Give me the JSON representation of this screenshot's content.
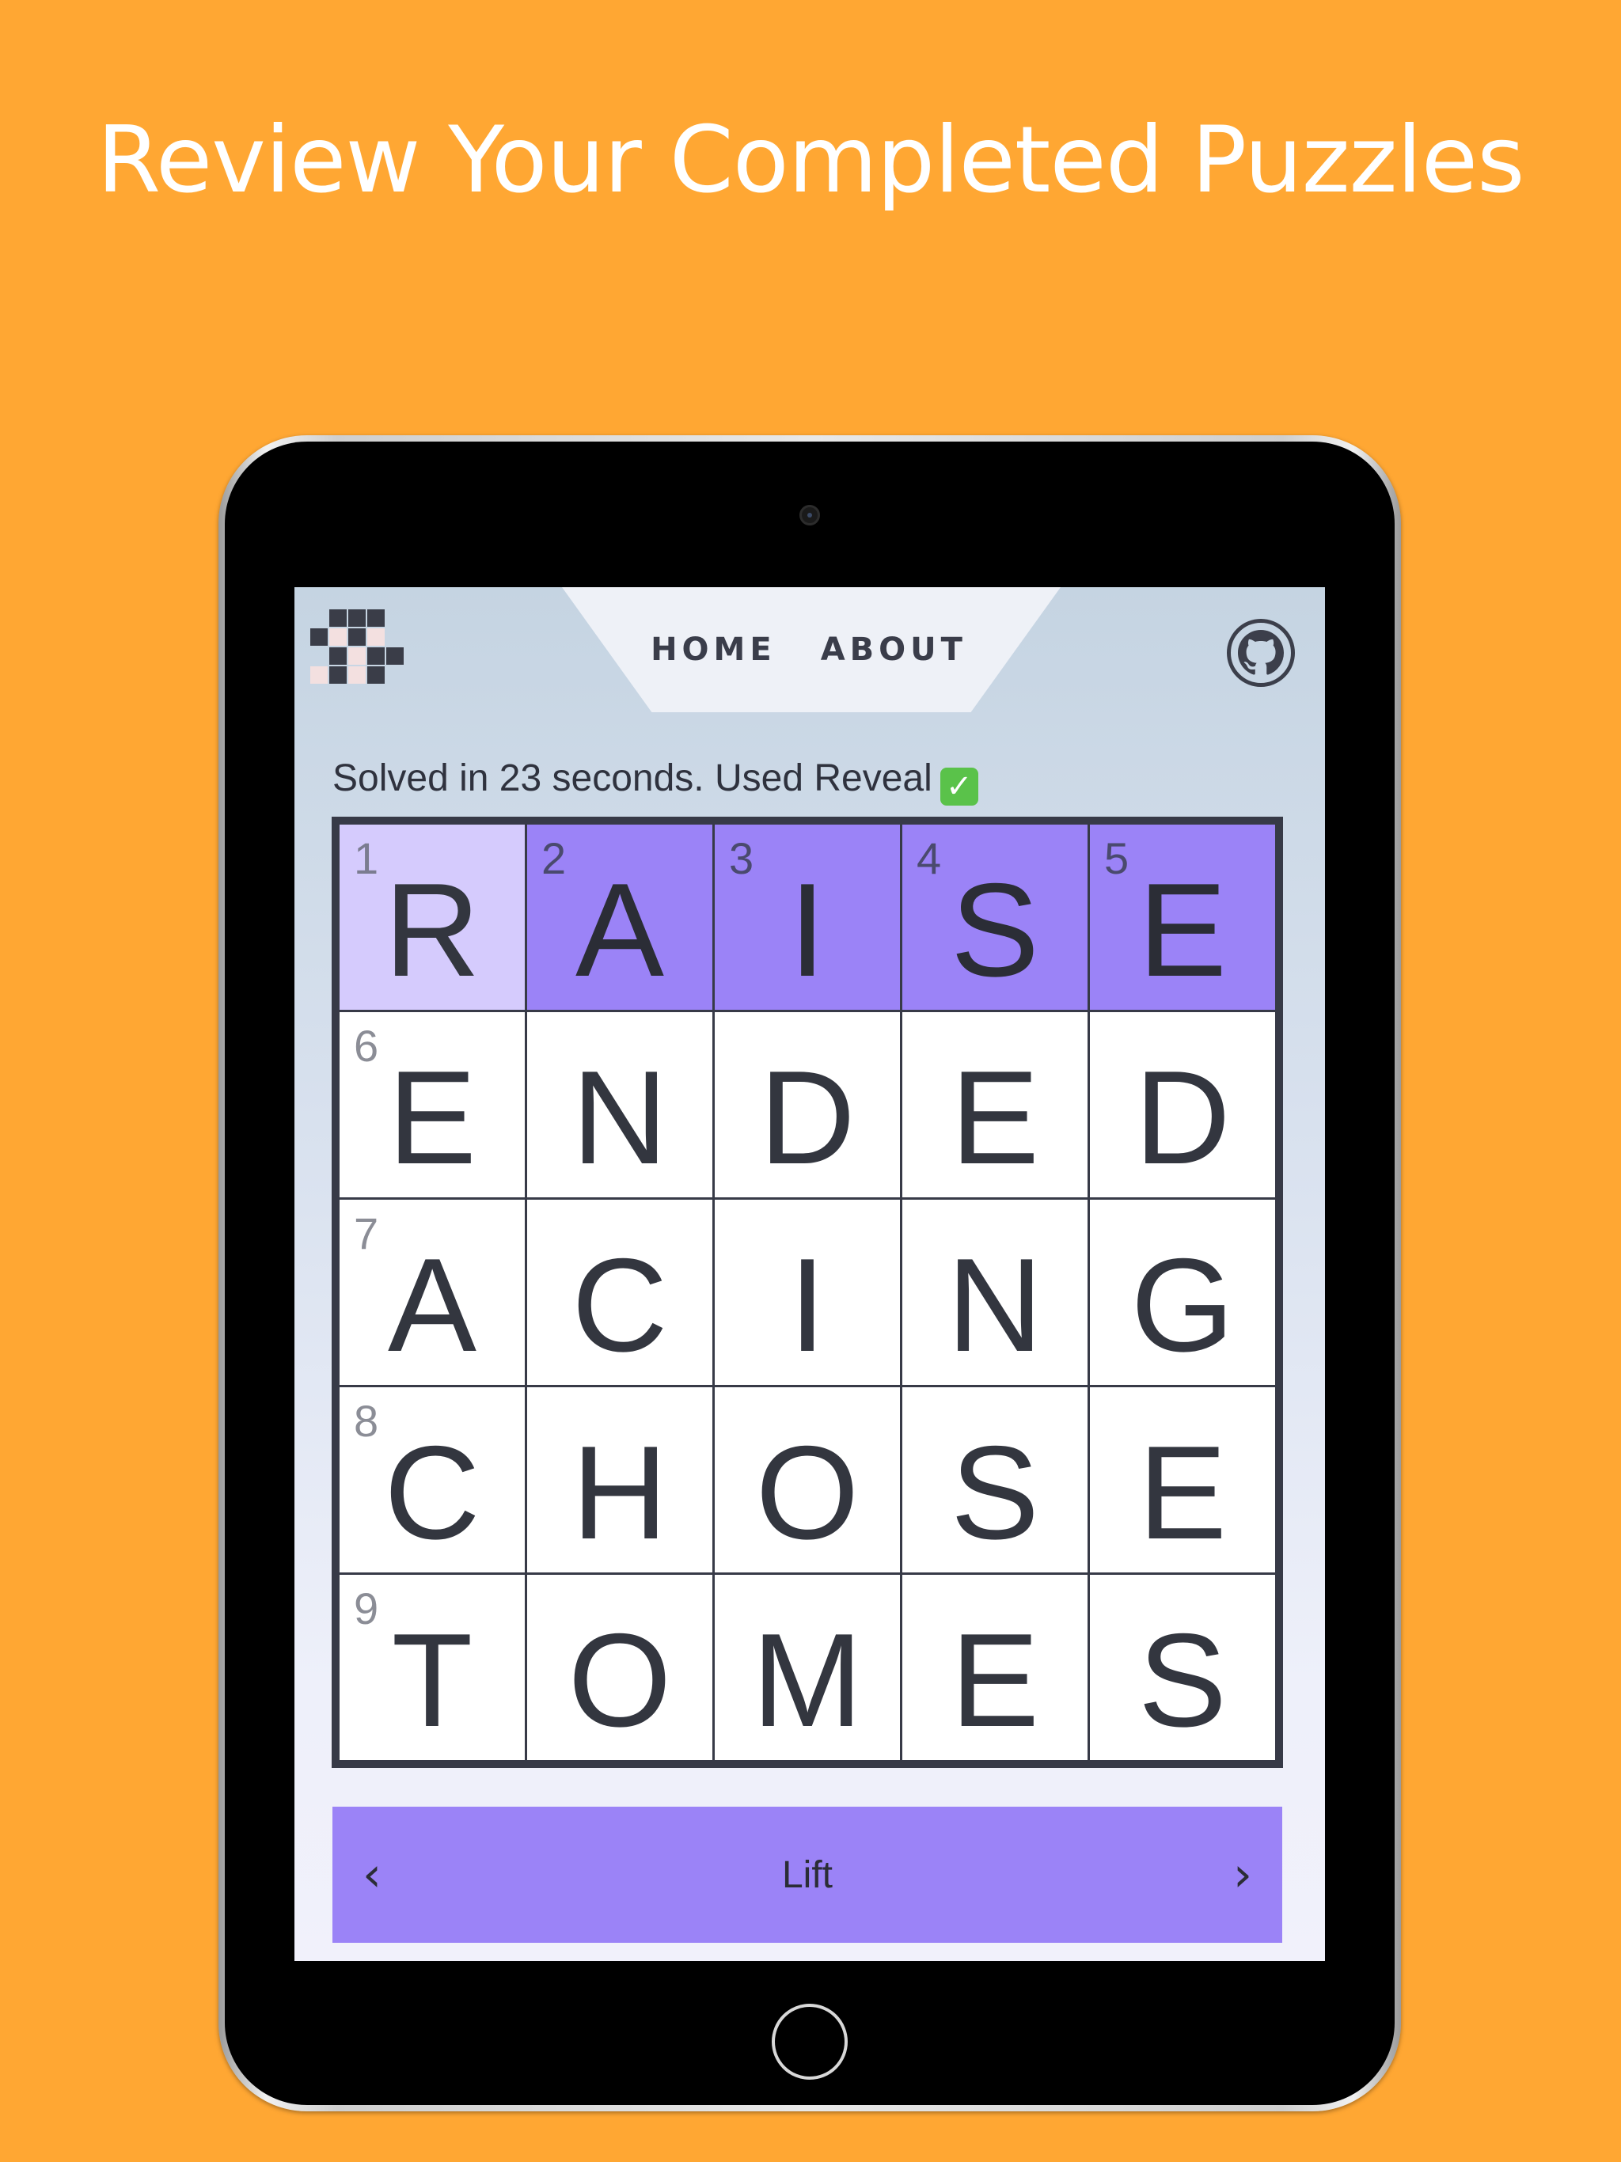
{
  "headline": "Review Your Completed Puzzles",
  "nav": {
    "home": "HOME",
    "about": "ABOUT"
  },
  "status": {
    "text": "Solved in 23 seconds. Used Reveal",
    "check": "✓"
  },
  "grid": {
    "rows": [
      [
        "R",
        "A",
        "I",
        "S",
        "E"
      ],
      [
        "E",
        "N",
        "D",
        "E",
        "D"
      ],
      [
        "A",
        "C",
        "I",
        "N",
        "G"
      ],
      [
        "C",
        "H",
        "O",
        "S",
        "E"
      ],
      [
        "T",
        "O",
        "M",
        "E",
        "S"
      ]
    ],
    "numbers": {
      "r0c0": "1",
      "r0c1": "2",
      "r0c2": "3",
      "r0c3": "4",
      "r0c4": "5",
      "r1c0": "6",
      "r2c0": "7",
      "r3c0": "8",
      "r4c0": "9"
    }
  },
  "clue": {
    "text": "Lift",
    "prev": "‹",
    "next": "›"
  },
  "icons": {
    "logo": "crossword-logo-icon",
    "github": "github-icon",
    "check": "check-icon"
  },
  "colors": {
    "background": "#FFA733",
    "highlight": "#9b83f7",
    "focus": "#d5cbfd",
    "ink": "#33363f"
  }
}
